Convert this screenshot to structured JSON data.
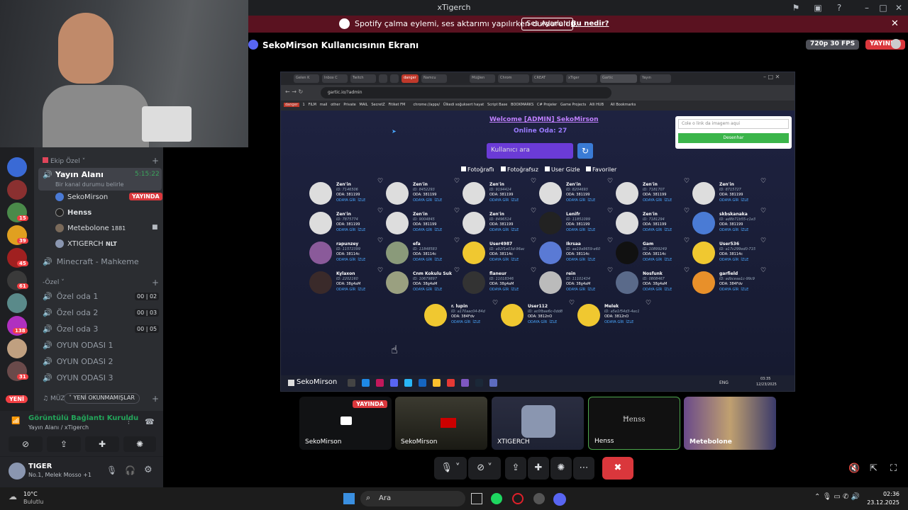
{
  "window": {
    "title": "xTigerch"
  },
  "notice": {
    "text": "Spotify çalma eylemi, ses aktarımı yapılırken durduruldu.",
    "button": "Ses Ayarları",
    "link": "Bu nedir?"
  },
  "stage": {
    "title": "SekoMirson Kullanıcısının Ekranı",
    "quality": "720p 30 FPS",
    "live": "YAYINDA"
  },
  "browser": {
    "url": "gartic.io/?admin",
    "tabs": [
      "Gelen K",
      "Inbox C",
      "Twitch",
      "",
      "",
      "danger",
      "Namcu",
      "Müğlen",
      "Chrom",
      "CREAT",
      "xTiger",
      "Gartic",
      "Yayın"
    ],
    "bookmarks": [
      "danger",
      "1",
      "FILM",
      "mail",
      "other",
      "Private",
      "MAIL",
      "SecretZ",
      "Fitiket FM",
      "chrome://apps/",
      "Ülkedi soğuksert hayat",
      "Script Base",
      "BOOKMARKS",
      "C# Projeler",
      "Game Projects",
      "Alli HUB",
      "All Bookmarks"
    ]
  },
  "site": {
    "welcome": "Welcome [ADMIN] SekoMirson",
    "online": "Online Oda: 27",
    "search_placeholder": "Kullanıcı ara",
    "filters": [
      "Fotoğraflı",
      "Fotoğrafsız",
      "User Gizle",
      "Favoriler"
    ],
    "paste_placeholder": "Cole o link da imagem aqui",
    "paste_button": "Desenhar",
    "join": "ODAYA GİR",
    "watch": "İZLE",
    "players": [
      {
        "name": "Zen'in",
        "id": "ID: 7146506",
        "oda": "ODA: 381199",
        "color": "#ddd"
      },
      {
        "name": "Zen'in",
        "id": "ID: 8452293",
        "oda": "ODA: 381199",
        "color": "#ddd"
      },
      {
        "name": "Zen'in",
        "id": "ID: 9194414",
        "oda": "ODA: 381199",
        "color": "#ddd"
      },
      {
        "name": "Zen'in",
        "id": "ID: 8204693",
        "oda": "ODA: 381199",
        "color": "#ddd"
      },
      {
        "name": "Zen'in",
        "id": "ID: 7181707",
        "oda": "ODA: 381199",
        "color": "#ddd"
      },
      {
        "name": "Zen'in",
        "id": "ID: 8715727",
        "oda": "ODA: 381199",
        "color": "#ddd"
      },
      {
        "name": "Zen'in",
        "id": "ID: 7875774",
        "oda": "ODA: 381199",
        "color": "#ddd"
      },
      {
        "name": "Zen'in",
        "id": "ID: 9004845",
        "oda": "ODA: 381199",
        "color": "#ddd"
      },
      {
        "name": "Zen'in",
        "id": "ID: 8496514",
        "oda": "ODA: 381199",
        "color": "#ddd"
      },
      {
        "name": "Lenifr",
        "id": "ID: 11851099",
        "oda": "ODA: 381199",
        "color": "#222"
      },
      {
        "name": "Zen'in",
        "id": "ID: 7181294",
        "oda": "ODA: 381199",
        "color": "#ddd"
      },
      {
        "name": "skbskanaka",
        "id": "ID: ad8b71b55-c1e3",
        "oda": "ODA: 381199",
        "color": "#4a7bd5"
      },
      {
        "name": "rapunzey",
        "id": "ID: 11572399",
        "oda": "ODA: 38114c",
        "color": "#8a5a9a"
      },
      {
        "name": " efa",
        "id": "ID: 11848583",
        "oda": "ODA: 38114c",
        "color": "#8a9a7a"
      },
      {
        "name": "User4987",
        "id": "ID: a92f1e03d-96ac",
        "oda": "ODA: 38114c",
        "color": "#f0c830"
      },
      {
        "name": "Ikrsaa",
        "id": "ID: aa19a9659-e60",
        "oda": "ODA: 38114c",
        "color": "#5a7ad5"
      },
      {
        "name": "Gam",
        "id": "ID: 10899249",
        "oda": "ODA: 38114c",
        "color": "#111"
      },
      {
        "name": "User536",
        "id": "ID: a17c299ed0-715",
        "oda": "ODA: 38114c",
        "color": "#f0c830"
      },
      {
        "name": "Kylaxon",
        "id": "ID: 2202160",
        "oda": "ODA: 38g4aM",
        "color": "#3a2a2a"
      },
      {
        "name": "Cnm Kokulu Suk",
        "id": "ID: 10679897",
        "oda": "ODA: 38g4aM",
        "color": "#9aa080"
      },
      {
        "name": "flaneur",
        "id": "ID: 11018346",
        "oda": "ODA: 38g4aM",
        "color": "#333"
      },
      {
        "name": "rein",
        "id": "ID: 11101434",
        "oda": "ODA: 38g4aM",
        "color": "#bbb"
      },
      {
        "name": "Nosfunk",
        "id": "ID: 0808467",
        "oda": "ODA: 38g4aM",
        "color": "#5a6a8a"
      },
      {
        "name": "garfield",
        "id": "ID: adbceaa1c-99c9",
        "oda": "ODA: 384Fdv",
        "color": "#e8902a"
      },
      {
        "name": "r. lupin",
        "id": "ID: a170aac04-84d",
        "oda": "ODA: 384Fdv",
        "color": "#f0c830"
      },
      {
        "name": "User112",
        "id": "ID: ac0fbae6c-0dd8",
        "oda": "ODA: 3812nO",
        "color": "#f0c830"
      },
      {
        "name": "Melek",
        "id": "ID: a5e1f54d3-4ec1",
        "oda": "ODA: 3812nO",
        "color": "#f0c830"
      }
    ],
    "screen_user": "SekoMirson",
    "screen_lang": "ENG",
    "screen_time": "03:35",
    "screen_date": "12/23/2025"
  },
  "tiles": [
    {
      "label": "SekoMirson",
      "live": "YAYINDA"
    },
    {
      "label": "SekoMirson"
    },
    {
      "label": "XTIGERCH"
    },
    {
      "label": "Henss"
    },
    {
      "label": "Metebolone"
    }
  ],
  "sidebar": {
    "server_badges": [
      "15",
      "39",
      "45",
      "61",
      "138",
      "31"
    ],
    "new_label": "YENİ",
    "categories": {
      "ekip": "Ekip Özel",
      "ozel": "-Özel",
      "muzik": "MÜZ"
    },
    "yayin": {
      "name": "Yayın Alanı",
      "time": "5:15:22",
      "status": "Bir kanal durumu belirle"
    },
    "voice_users": [
      {
        "name": "SekoMirson",
        "tag": "YAYINDA"
      },
      {
        "name": "Henss"
      },
      {
        "name": "Metebolone",
        "count": "1881"
      },
      {
        "name": "XTIGERCH",
        "tag": "NLT"
      }
    ],
    "channels": [
      {
        "name": "Minecraft - Mahkeme"
      },
      {
        "name": "Özel oda 1",
        "a": "00",
        "b": "02"
      },
      {
        "name": "Özel oda 2",
        "a": "00",
        "b": "03"
      },
      {
        "name": "Özel oda 3",
        "a": "00",
        "b": "05"
      },
      {
        "name": "OYUN ODASI 1"
      },
      {
        "name": "OYUN ODASI 2"
      },
      {
        "name": "OYUN ODASI 3"
      }
    ],
    "unread": "YENİ OKUNMAMIŞLAR"
  },
  "connection": {
    "title": "Görüntülü Bağlantı Kuruldu",
    "sub": "Yayın Alanı / xTigerch"
  },
  "user": {
    "name": "TIGER",
    "status": "No.1, Melek Mosso +1"
  },
  "taskbar": {
    "weather_temp": "10°C",
    "weather_desc": "Bulutlu",
    "search": "Ara",
    "time": "02:36",
    "date": "23.12.2025"
  }
}
